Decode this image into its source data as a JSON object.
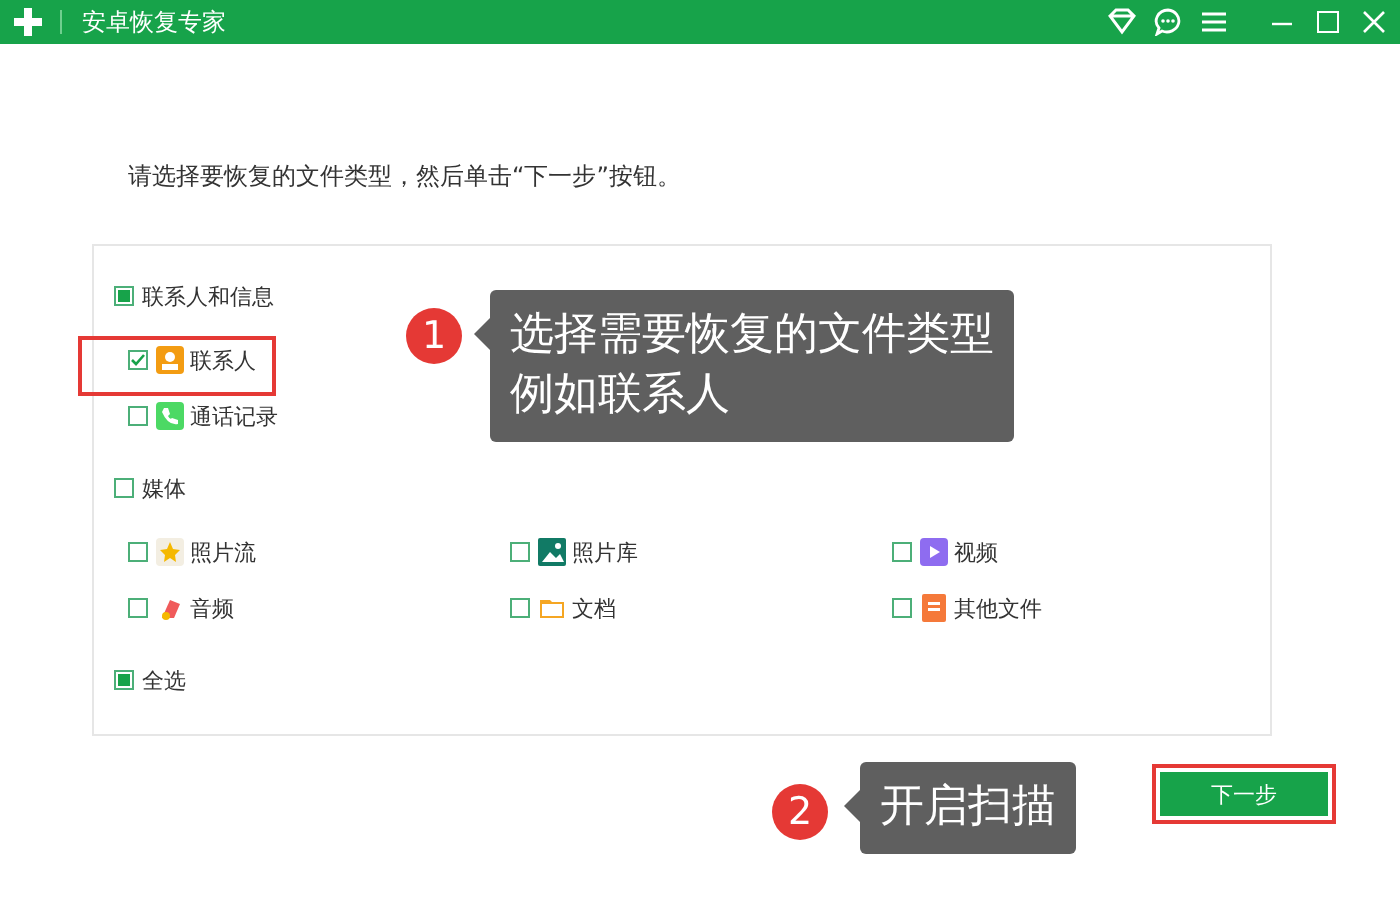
{
  "window": {
    "title": "安卓恢复专家"
  },
  "instruction": "请选择要恢复的文件类型，然后单击“下一步”按钮。",
  "groups": [
    {
      "label": "联系人和信息",
      "checked": false,
      "partial": true,
      "rows": [
        [
          {
            "label": "联系人",
            "checked": true
          }
        ],
        [
          {
            "label": "通话记录",
            "checked": false
          }
        ]
      ]
    },
    {
      "label": "媒体",
      "checked": false,
      "partial": false,
      "rows": [
        [
          {
            "label": "照片流",
            "checked": false
          },
          {
            "label": "照片库",
            "checked": false
          },
          {
            "label": "视频",
            "checked": false
          }
        ],
        [
          {
            "label": "音频",
            "checked": false
          },
          {
            "label": "文档",
            "checked": false
          },
          {
            "label": "其他文件",
            "checked": false
          }
        ]
      ]
    }
  ],
  "select_all": {
    "label": "全选",
    "checked": false,
    "partial": true
  },
  "next_button": "下一步",
  "callouts": [
    {
      "number": "1",
      "lines": [
        "选择需要恢复的文件类型",
        "例如联系人"
      ]
    },
    {
      "number": "2",
      "lines": [
        "开启扫描"
      ]
    }
  ]
}
